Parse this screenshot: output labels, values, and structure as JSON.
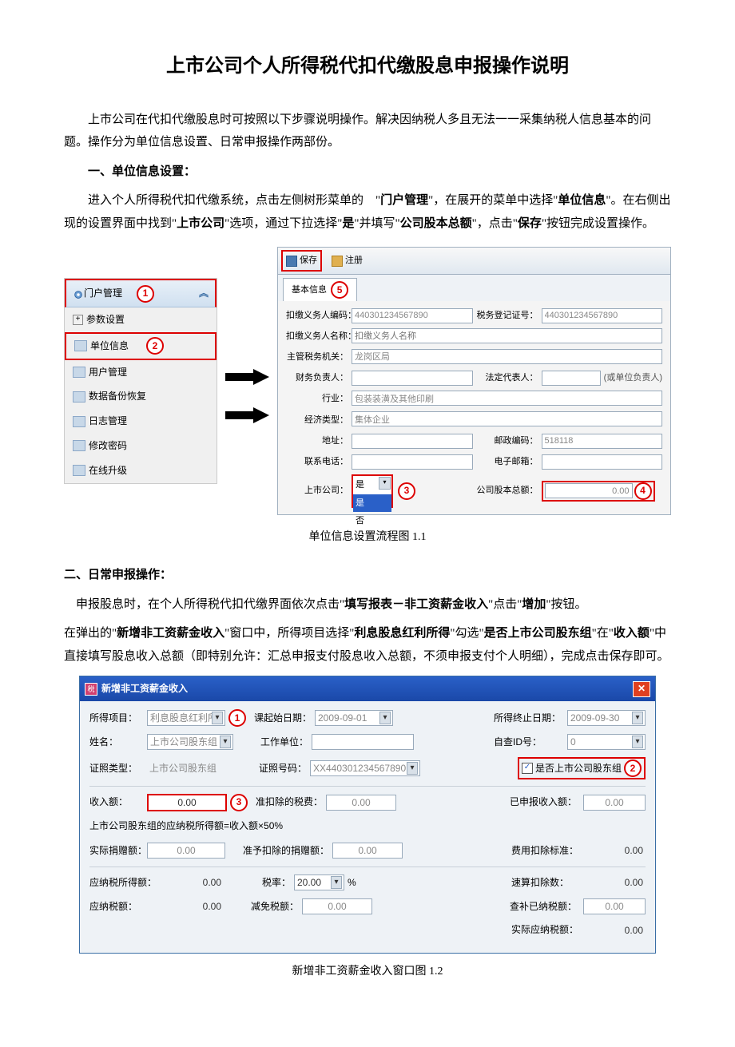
{
  "title": "上市公司个人所得税代扣代缴股息申报操作说明",
  "intro": "上市公司在代扣代缴股息时可按照以下步骤说明操作。解决因纳税人多且无法一一采集纳税人信息基本的问题。操作分为单位信息设置、日常申报操作两部份。",
  "section1": {
    "heading": "一、单位信息设置：",
    "body_parts": [
      "进入个人所得税代扣代缴系统，点击左侧树形菜单的　\"",
      "门户管理",
      "\"，在展开的菜单中选择\"",
      "单位信息",
      "\"。在右侧出现的设置界面中找到\"",
      "上市公司",
      "\"选项，通过下拉选择\"",
      "是",
      "\"并填写\"",
      "公司股本总额",
      "\"，点击\"",
      "保存",
      "\"按钮完成设置操作。"
    ]
  },
  "sidebar": {
    "header": "门户管理",
    "chev": "︽",
    "items": [
      "参数设置",
      "单位信息",
      "用户管理",
      "数据备份恢复",
      "日志管理",
      "修改密码",
      "在线升级"
    ]
  },
  "markers": {
    "n1": "1",
    "n2": "2",
    "n3": "3",
    "n4": "4",
    "n5": "5"
  },
  "form": {
    "save_btn": "保存",
    "reg_btn": "注册",
    "tab": "基本信息",
    "rows": {
      "code_l": "扣缴义务人编码：",
      "code_v": "440301234567890",
      "taxreg_l": "税务登记证号：",
      "taxreg_v": "440301234567890",
      "name_l": "扣缴义务人名称：",
      "name_v": "扣缴义务人名称",
      "organ_l": "主管税务机关：",
      "organ_v": "龙岗区局",
      "fin_l": "财务负责人：",
      "legal_l": "法定代表人：",
      "legal_note": "(或单位负责人)",
      "ind_l": "行业：",
      "ind_v": "包装装潢及其他印刷",
      "econ_l": "经济类型：",
      "econ_v": "集体企业",
      "addr_l": "地址：",
      "post_l": "邮政编码：",
      "post_v": "518118",
      "tel_l": "联系电话：",
      "email_l": "电子邮箱：",
      "listed_l": "上市公司：",
      "listed_opts": [
        "是",
        "是",
        "否"
      ],
      "cap_l": "公司股本总额：",
      "cap_v": "0.00"
    }
  },
  "caption1": "单位信息设置流程图 1.1",
  "section2": {
    "heading": "二、日常申报操作：",
    "p1_parts": [
      "申报股息时，在个人所得税代扣代缴界面依次点击\"",
      "填写报表－非工资薪金收入",
      "\"点击\"",
      "增加",
      "\"按钮。"
    ],
    "p2_parts": [
      "在弹出的\"",
      "新增非工资薪金收入",
      "\"窗口中，所得项目选择\"",
      "利息股息红利所得",
      "\"勾选\"",
      "是否上市公司股东组",
      "\"在\"",
      "收入额",
      "\"中直接填写股息收入总额（即特别允许：汇总申报支付股息收入总额，不须申报支付个人明细），完成点击保存即可。"
    ]
  },
  "dialog": {
    "title": "新增非工资薪金收入",
    "icon": "税",
    "r1": {
      "proj_l": "所得项目：",
      "proj_v": "利息股息红利所",
      "start_l": "课起始日期：",
      "start_v": "2009-09-01",
      "end_l": "所得终止日期：",
      "end_v": "2009-09-30"
    },
    "r2": {
      "name_l": "姓名：",
      "name_v": "上市公司股东组",
      "work_l": "工作单位：",
      "self_l": "自查ID号：",
      "self_v": "0"
    },
    "r3": {
      "cert_l": "证照类型：",
      "cert_v": "上市公司股东组",
      "certno_l": "证照号码：",
      "certno_v": "XX440301234567890",
      "chk_l": "是否上市公司股东组"
    },
    "r4": {
      "income_l": "收入额：",
      "income_v": "0.00",
      "fee_l": "准扣除的税费：",
      "fee_v": "0.00",
      "decl_l": "已申报收入额：",
      "decl_v": "0.00"
    },
    "note": "上市公司股东组的应纳税所得额=收入额×50%",
    "r5": {
      "don_l": "实际捐赠额：",
      "don_v": "0.00",
      "allow_l": "准予扣除的捐赠额：",
      "allow_v": "0.00",
      "std_l": "费用扣除标准：",
      "std_v": "0.00"
    },
    "r6": {
      "taxable_l": "应纳税所得额：",
      "taxable_v": "0.00",
      "rate_l": "税率：",
      "rate_v": "20.00",
      "pct": "%",
      "quick_l": "速算扣除数：",
      "quick_v": "0.00"
    },
    "r7": {
      "due_l": "应纳税额：",
      "due_v": "0.00",
      "relief_l": "减免税额：",
      "relief_v": "0.00",
      "paid_l": "查补已纳税额：",
      "paid_v": "0.00"
    },
    "r8": {
      "real_l": "实际应纳税额：",
      "real_v": "0.00"
    }
  },
  "caption2": "新增非工资薪金收入窗口图 1.2"
}
